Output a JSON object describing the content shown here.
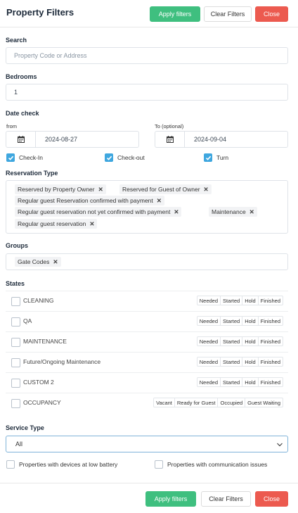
{
  "header": {
    "title": "Property Filters",
    "apply_label": "Apply filters",
    "clear_label": "Clear Filters",
    "close_label": "Close"
  },
  "search": {
    "label": "Search",
    "placeholder": "Property Code or Address"
  },
  "bedrooms": {
    "label": "Bedrooms",
    "value": "1"
  },
  "date_check": {
    "label": "Date check",
    "from_label": "from",
    "from_value": "2024-08-27",
    "to_label": "To (optional)",
    "to_value": "2024-09-04",
    "checks": [
      {
        "label": "Check-In",
        "checked": true
      },
      {
        "label": "Check-out",
        "checked": true
      },
      {
        "label": "Turn",
        "checked": true
      }
    ]
  },
  "reservation_type": {
    "label": "Reservation Type",
    "tags": [
      "Reserved by Property Owner",
      "Reserved for Guest of Owner",
      "Regular guest Reservation confirmed with payment",
      "Regular guest reservation not yet confirmed with payment",
      "Maintenance",
      "Regular guest reservation"
    ]
  },
  "groups": {
    "label": "Groups",
    "tags": [
      "Gate Codes"
    ]
  },
  "states": {
    "label": "States",
    "rows": [
      {
        "name": "CLEANING",
        "options": [
          "Needed",
          "Started",
          "Hold",
          "Finished"
        ]
      },
      {
        "name": "QA",
        "options": [
          "Needed",
          "Started",
          "Hold",
          "Finished"
        ]
      },
      {
        "name": "MAINTENANCE",
        "options": [
          "Needed",
          "Started",
          "Hold",
          "Finished"
        ]
      },
      {
        "name": "Future/Ongoing Maintenance",
        "options": [
          "Needed",
          "Started",
          "Hold",
          "Finished"
        ]
      },
      {
        "name": "CUSTOM 2",
        "options": [
          "Needed",
          "Started",
          "Hold",
          "Finished"
        ]
      },
      {
        "name": "OCCUPANCY",
        "options": [
          "Vacant",
          "Ready for Guest",
          "Occupied",
          "Guest Waiting"
        ]
      }
    ]
  },
  "service_type": {
    "label": "Service Type",
    "value": "All"
  },
  "extra_checks": [
    {
      "label": "Properties with devices at low battery",
      "checked": false
    },
    {
      "label": "Properties with communication issues",
      "checked": false
    }
  ],
  "footer": {
    "apply_label": "Apply filters",
    "clear_label": "Clear Filters",
    "close_label": "Close"
  },
  "colors": {
    "accent_green": "#3fbf7f",
    "accent_red": "#ec5a4f",
    "checkbox_blue": "#3fa7df"
  }
}
